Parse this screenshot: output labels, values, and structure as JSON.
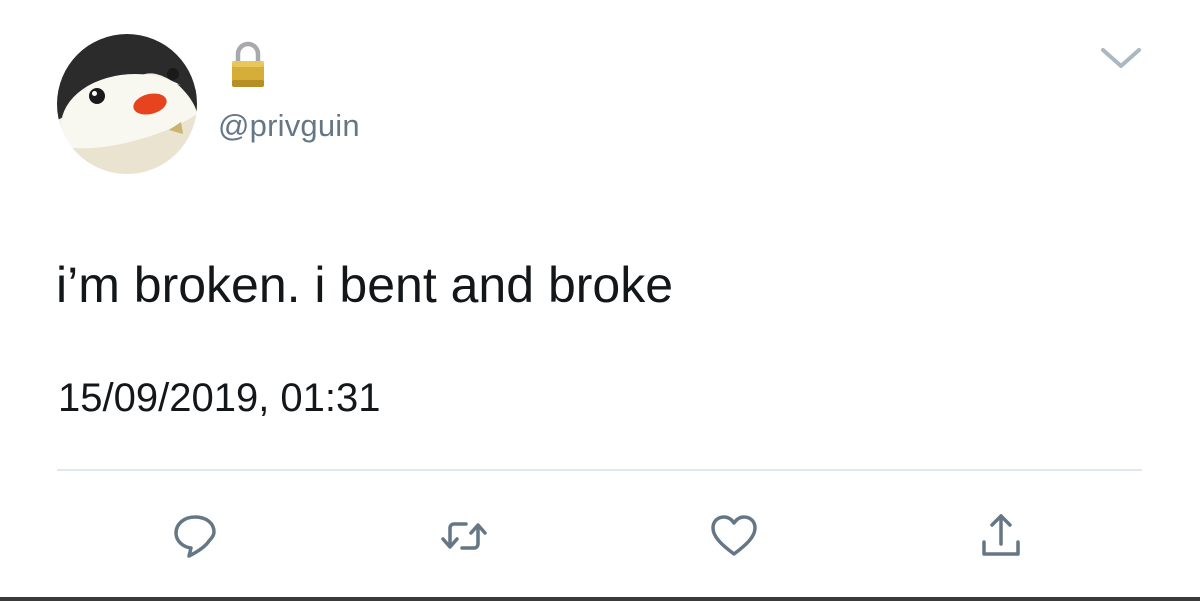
{
  "tweet": {
    "handle": "@privguin",
    "text": "i’m broken. i bent and broke",
    "timestamp": "15/09/2019, 01:31",
    "locked": true
  },
  "icons": {
    "avatar": "penguin-avatar",
    "lock": "lock-icon",
    "menu": "chevron-down-icon",
    "reply": "reply-icon",
    "retweet": "retweet-icon",
    "like": "heart-icon",
    "share": "share-icon"
  },
  "colors": {
    "text": "#14171a",
    "secondary": "#657786",
    "divider": "#e1e8ed",
    "icon": "#657786",
    "chevron": "#aab8c2",
    "beak": "#e8431f",
    "lock": "#c9a227"
  }
}
